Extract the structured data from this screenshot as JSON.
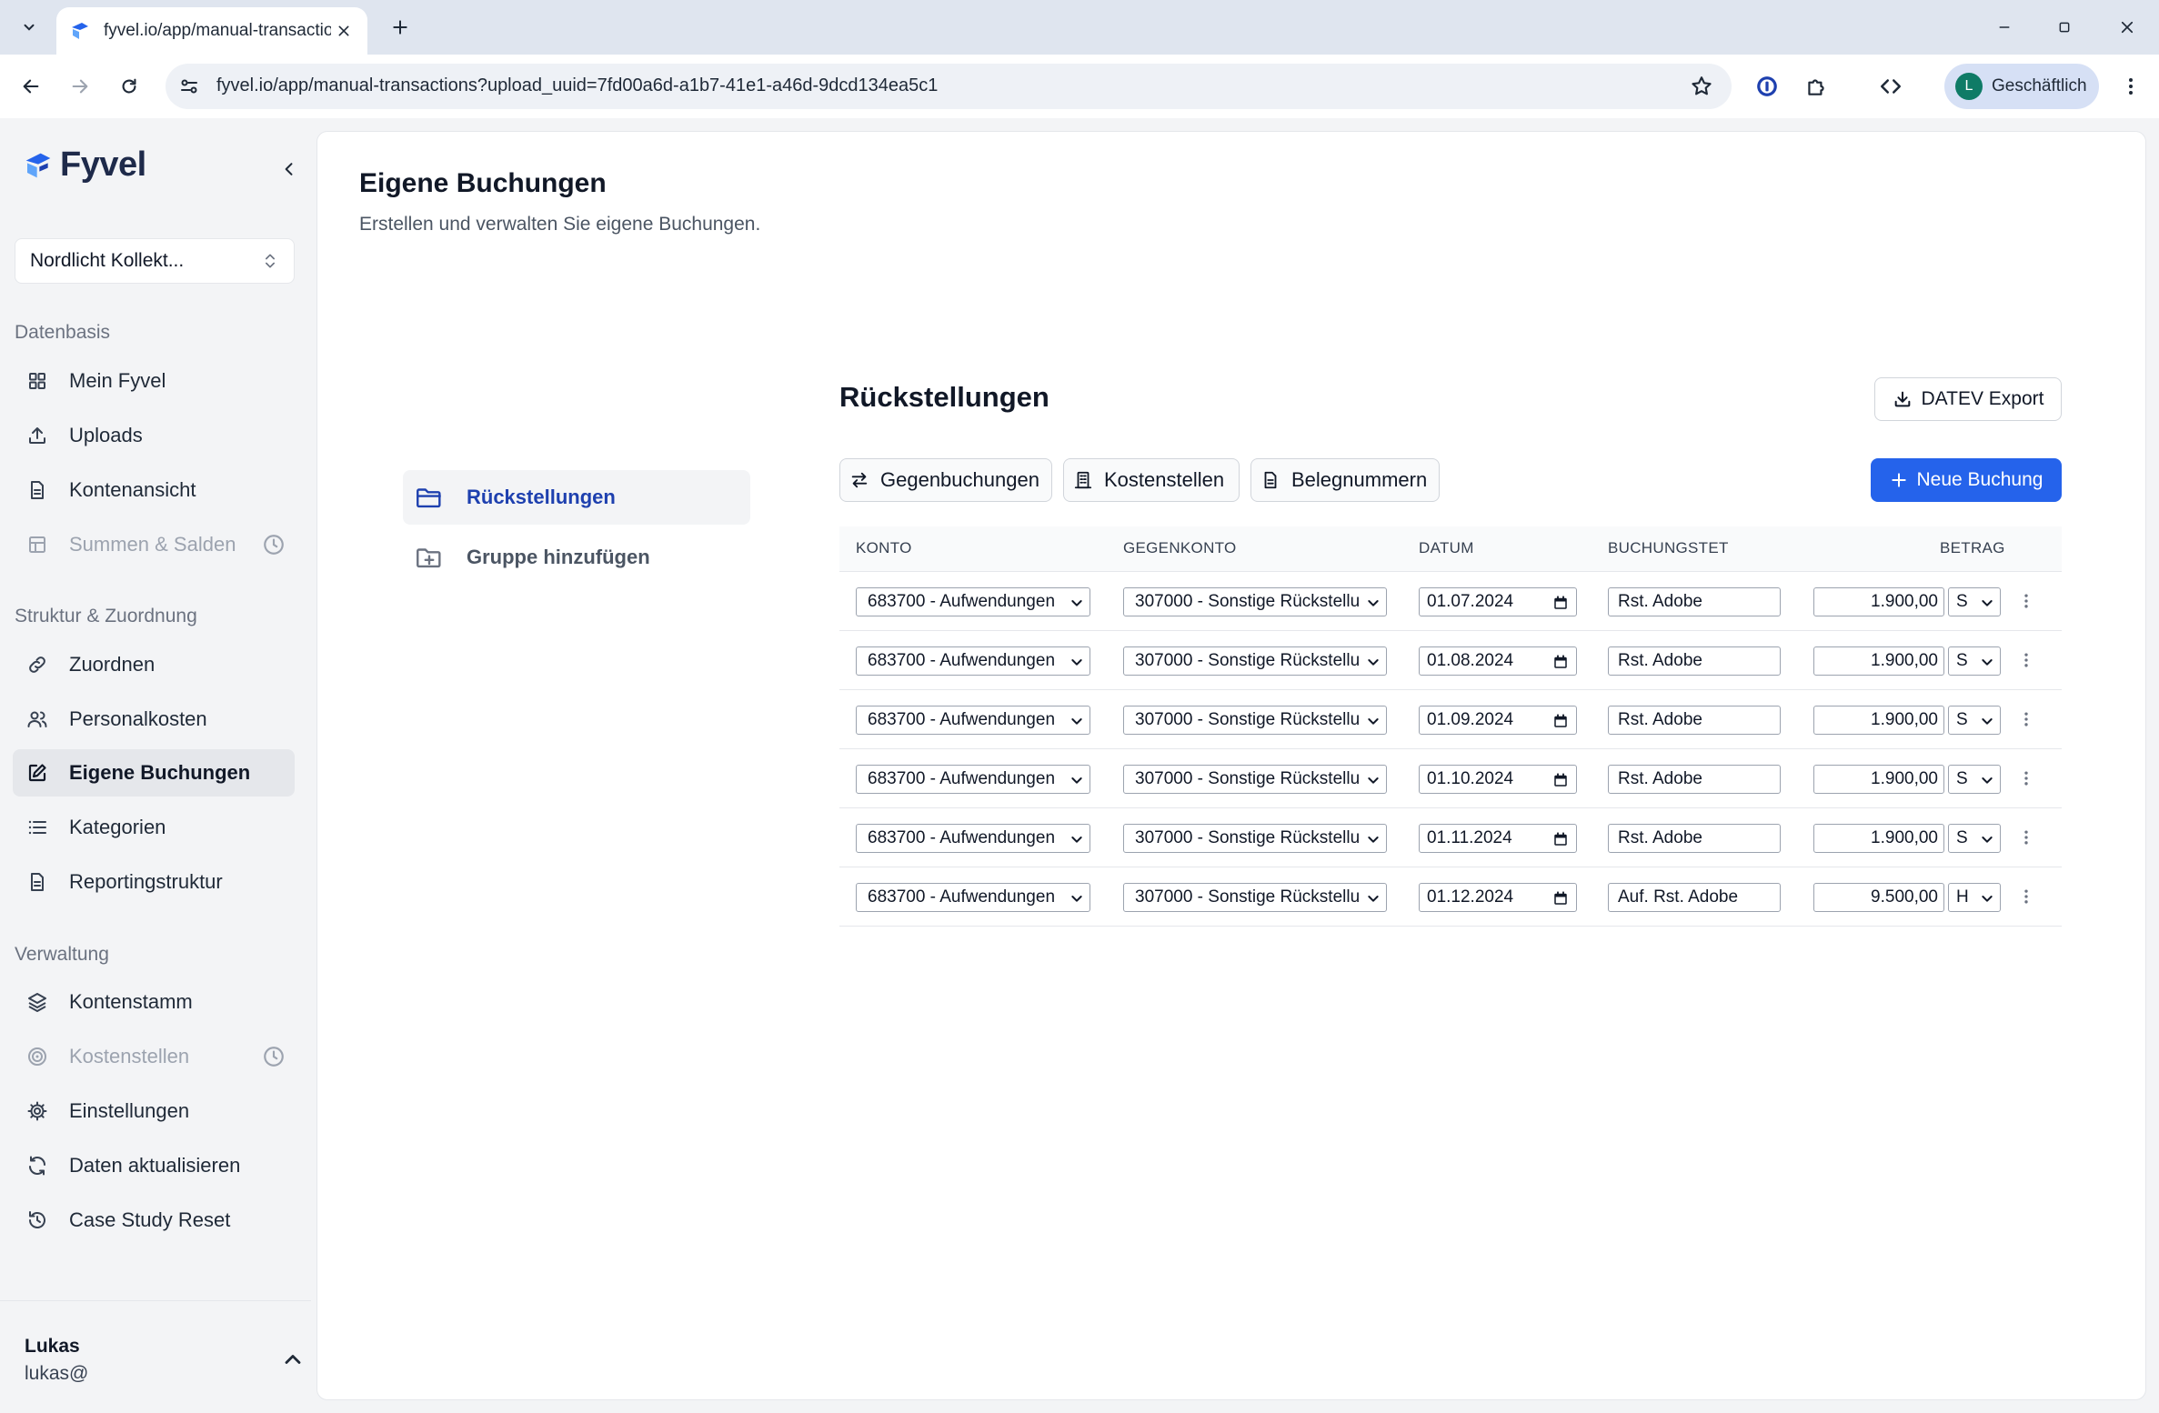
{
  "browser": {
    "tab_title": "fyvel.io/app/manual-transaction",
    "url": "fyvel.io/app/manual-transactions?upload_uuid=7fd00a6d-a1b7-41e1-a46d-9dcd134ea5c1",
    "profile_initial": "L",
    "profile_name": "Geschäftlich"
  },
  "sidebar": {
    "logo": "Fyvel",
    "org": "Nordlicht Kollekt...",
    "sections": {
      "datenbasis": "Datenbasis",
      "struktur": "Struktur & Zuordnung",
      "verwaltung": "Verwaltung"
    },
    "items": [
      {
        "label": "Mein Fyvel",
        "icon": "grid-icon"
      },
      {
        "label": "Uploads",
        "icon": "upload-icon"
      },
      {
        "label": "Kontenansicht",
        "icon": "document-icon"
      },
      {
        "label": "Summen & Salden",
        "icon": "table-icon",
        "disabled": true
      },
      {
        "label": "Zuordnen",
        "icon": "link-icon"
      },
      {
        "label": "Personalkosten",
        "icon": "users-icon"
      },
      {
        "label": "Eigene Buchungen",
        "icon": "edit-icon",
        "active": true
      },
      {
        "label": "Kategorien",
        "icon": "list-icon"
      },
      {
        "label": "Reportingstruktur",
        "icon": "document-icon"
      },
      {
        "label": "Kontenstamm",
        "icon": "layers-icon"
      },
      {
        "label": "Kostenstellen",
        "icon": "target-icon",
        "disabled": true
      },
      {
        "label": "Einstellungen",
        "icon": "gear-icon"
      },
      {
        "label": "Daten aktualisieren",
        "icon": "refresh-icon"
      },
      {
        "label": "Case Study Reset",
        "icon": "history-icon"
      }
    ],
    "user": {
      "name": "Lukas",
      "email": "lukas@"
    }
  },
  "page": {
    "title": "Eigene Buchungen",
    "subtitle": "Erstellen und verwalten Sie eigene Buchungen."
  },
  "groups": [
    {
      "label": "Rückstellungen",
      "active": true
    },
    {
      "label": "Gruppe hinzufügen"
    }
  ],
  "section": {
    "title": "Rückstellungen",
    "export_label": "DATEV Export",
    "buttons": {
      "gegenbuchungen": "Gegenbuchungen",
      "kostenstellen": "Kostenstellen",
      "belegnummern": "Belegnummern",
      "neue_buchung": "Neue Buchung"
    }
  },
  "table": {
    "headers": {
      "konto": "KONTO",
      "gegenkonto": "GEGENKONTO",
      "datum": "DATUM",
      "buchungstext": "BUCHUNGSTET",
      "betrag": "BETRAG"
    },
    "rows": [
      {
        "konto": "683700 - Aufwendungen",
        "gegenkonto": "307000 - Sonstige Rückstellu",
        "datum": "01.07.2024",
        "text": "Rst. Adobe",
        "betrag": "1.900,00",
        "sh": "S"
      },
      {
        "konto": "683700 - Aufwendungen",
        "gegenkonto": "307000 - Sonstige Rückstellu",
        "datum": "01.08.2024",
        "text": "Rst. Adobe",
        "betrag": "1.900,00",
        "sh": "S"
      },
      {
        "konto": "683700 - Aufwendungen",
        "gegenkonto": "307000 - Sonstige Rückstellu",
        "datum": "01.09.2024",
        "text": "Rst. Adobe",
        "betrag": "1.900,00",
        "sh": "S"
      },
      {
        "konto": "683700 - Aufwendungen",
        "gegenkonto": "307000 - Sonstige Rückstellu",
        "datum": "01.10.2024",
        "text": "Rst. Adobe",
        "betrag": "1.900,00",
        "sh": "S"
      },
      {
        "konto": "683700 - Aufwendungen",
        "gegenkonto": "307000 - Sonstige Rückstellu",
        "datum": "01.11.2024",
        "text": "Rst. Adobe",
        "betrag": "1.900,00",
        "sh": "S"
      },
      {
        "konto": "683700 - Aufwendungen",
        "gegenkonto": "307000 - Sonstige Rückstellu",
        "datum": "01.12.2024",
        "text": "Auf. Rst. Adobe",
        "betrag": "9.500,00",
        "sh": "H"
      }
    ]
  },
  "colors": {
    "accent": "#2563eb",
    "active_group": "#1e40af",
    "brand_dark": "#1e2a4a"
  }
}
